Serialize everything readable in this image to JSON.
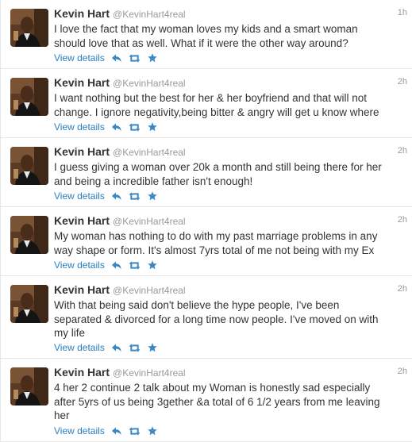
{
  "tweets": [
    {
      "name": "Kevin Hart",
      "handle": "@KevinHart4real",
      "time": "1h",
      "lines": [
        "I love the fact that my woman loves my kids and a smart woman",
        "should love that as well. What if it were the other way around?"
      ],
      "view_details": "View details"
    },
    {
      "name": "Kevin Hart",
      "handle": "@KevinHart4real",
      "time": "2h",
      "lines": [
        "I want nothing but the best for her & her boyfriend and that will not",
        "change. I ignore negativity,being bitter & angry will get u know where"
      ],
      "view_details": "View details"
    },
    {
      "name": "Kevin Hart",
      "handle": "@KevinHart4real",
      "time": "2h",
      "lines": [
        "I guess giving a woman over 20k a month and still being there for her",
        "and being a incredible father isn't enough!"
      ],
      "view_details": "View details"
    },
    {
      "name": "Kevin Hart",
      "handle": "@KevinHart4real",
      "time": "2h",
      "lines": [
        "My woman has nothing to do with my past marriage problems in any",
        "way shape or form. It's almost 7yrs total of me not being with my Ex"
      ],
      "view_details": "View details"
    },
    {
      "name": "Kevin Hart",
      "handle": "@KevinHart4real",
      "time": "2h",
      "lines": [
        "With that being said don't believe the hype people, I've been",
        "separated & divorced for a long time now people. I've moved on with",
        "my life"
      ],
      "view_details": "View details"
    },
    {
      "name": "Kevin Hart",
      "handle": "@KevinHart4real",
      "time": "2h",
      "lines": [
        "4 her 2 continue 2 talk about my Woman is honestly sad especially",
        "after 5yrs of us being 3gether &a total of 6 1/2 years from me leaving",
        "her"
      ],
      "view_details": "View details"
    }
  ],
  "icons": {
    "reply": "reply-icon",
    "retweet": "retweet-icon",
    "favorite": "star-icon"
  },
  "colors": {
    "link": "#2a7fc1",
    "action_icon": "#3b88c3",
    "muted": "#999999",
    "text": "#333333",
    "divider": "#e8e8e8"
  }
}
